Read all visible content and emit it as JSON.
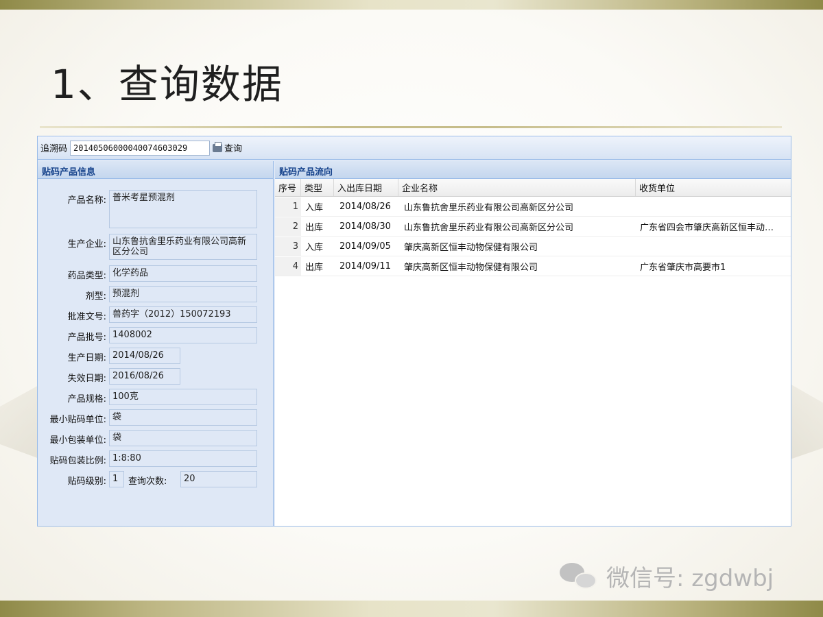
{
  "slide": {
    "title": "1、查询数据",
    "watermark_text": "微信号: zgdwbj",
    "watermark_icon": "wechat-icon"
  },
  "toolbar": {
    "trace_label": "追溯码",
    "trace_value": "20140506000040074603029",
    "search_label": "查询",
    "search_icon": "printer-icon"
  },
  "product_info": {
    "panel_title": "贴码产品信息",
    "fields": [
      {
        "label": "产品名称:",
        "value": "普米考星预混剂"
      },
      {
        "label": "生产企业:",
        "value": "山东鲁抗舍里乐药业有限公司高新区分公司"
      },
      {
        "label": "药品类型:",
        "value": "化学药品"
      },
      {
        "label": "剂型:",
        "value": "预混剂"
      },
      {
        "label": "批准文号:",
        "value": "兽药字（2012）150072193"
      },
      {
        "label": "产品批号:",
        "value": "1408002"
      },
      {
        "label": "生产日期:",
        "value": "2014/08/26"
      },
      {
        "label": "失效日期:",
        "value": "2016/08/26"
      },
      {
        "label": "产品规格:",
        "value": "100克"
      },
      {
        "label": "最小贴码单位:",
        "value": "袋"
      },
      {
        "label": "最小包装单位:",
        "value": "袋"
      },
      {
        "label": "贴码包装比例:",
        "value": "1:8:80"
      },
      {
        "label": "贴码级别:",
        "value": "1"
      }
    ],
    "query_count_label": "查询次数:",
    "query_count_value": "20"
  },
  "flow": {
    "panel_title": "贴码产品流向",
    "columns": [
      "序号",
      "类型",
      "入出库日期",
      "企业名称",
      "收货单位"
    ],
    "rows": [
      {
        "no": "1",
        "type": "入库",
        "date": "2014/08/26",
        "company": "山东鲁抗舍里乐药业有限公司高新区分公司",
        "receiver": ""
      },
      {
        "no": "2",
        "type": "出库",
        "date": "2014/08/30",
        "company": "山东鲁抗舍里乐药业有限公司高新区分公司",
        "receiver": "广东省四会市肇庆高新区恒丰动…"
      },
      {
        "no": "3",
        "type": "入库",
        "date": "2014/09/05",
        "company": "肇庆高新区恒丰动物保健有限公司",
        "receiver": ""
      },
      {
        "no": "4",
        "type": "出库",
        "date": "2014/09/11",
        "company": "肇庆高新区恒丰动物保健有限公司",
        "receiver": "广东省肇庆市高要市1"
      }
    ]
  }
}
